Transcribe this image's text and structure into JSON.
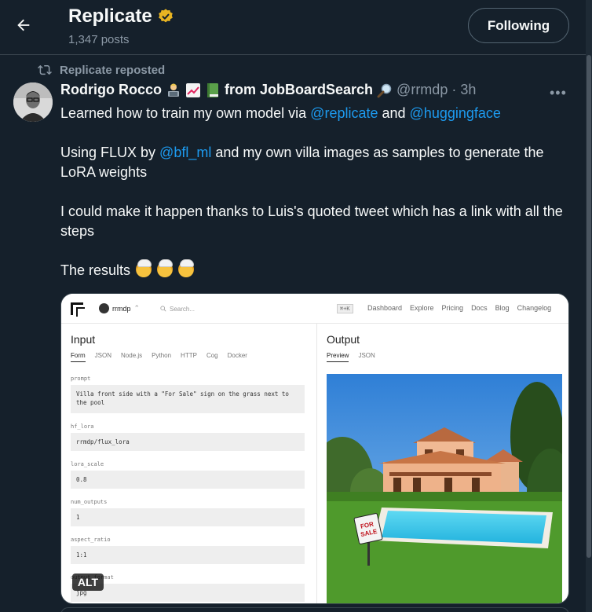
{
  "header": {
    "title": "Replicate",
    "posts_count": "1,347 posts",
    "follow_label": "Following"
  },
  "repost": {
    "label": "Replicate reposted"
  },
  "tweet": {
    "author_name": "Rodrigo Rocco",
    "author_suffix": "from JobBoardSearch",
    "handle": "@rrmdp",
    "time": "· 3h",
    "more_label": "•••",
    "line1_pre": "Learned how to train my own model via ",
    "line1_m1": "@replicate",
    "line1_mid": " and ",
    "line1_m2": "@huggingface",
    "line2_pre": "Using FLUX by ",
    "line2_m1": "@bfl_ml",
    "line2_post": " and my own villa images as samples to generate the LoRA weights",
    "line3": "I could make it happen thanks to Luis's quoted tweet which has a link with all the steps",
    "line4": "The results"
  },
  "media": {
    "alt_label": "ALT",
    "nav": {
      "user": "rrmdp",
      "search_placeholder": "Search...",
      "kbd": "⌘+K",
      "links": [
        "Dashboard",
        "Explore",
        "Pricing",
        "Docs",
        "Blog",
        "Changelog"
      ]
    },
    "input": {
      "title": "Input",
      "tabs": [
        "Form",
        "JSON",
        "Node.js",
        "Python",
        "HTTP",
        "Cog",
        "Docker"
      ],
      "fields": [
        {
          "label": "prompt",
          "value": "Villa front side with a \"For Sale\" sign on the grass next to the pool"
        },
        {
          "label": "hf_lora",
          "value": "rrmdp/flux_lora"
        },
        {
          "label": "lora_scale",
          "value": "0.8"
        },
        {
          "label": "num_outputs",
          "value": "1"
        },
        {
          "label": "aspect_ratio",
          "value": "1:1"
        },
        {
          "label": "output_format",
          "value": "jpg"
        }
      ]
    },
    "output": {
      "title": "Output",
      "tabs": [
        "Preview",
        "JSON"
      ],
      "sign_text_1": "FOR",
      "sign_text_2": "SALE"
    }
  },
  "icons": {
    "back": "arrow-left-icon",
    "verified": "verified-badge-icon",
    "repost": "repost-icon",
    "search": "magnifier-icon"
  },
  "colors": {
    "background": "#15202b",
    "text": "#f7f9f9",
    "muted": "#8b98a5",
    "link": "#1d9bf0",
    "border": "#38444d",
    "verified_gold": "#e8b422"
  }
}
